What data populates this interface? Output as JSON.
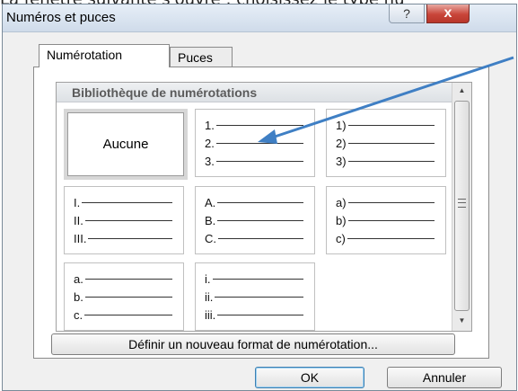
{
  "background_text": "La fenêtre suivante s'ouvre : choisissez le type nu",
  "dialog": {
    "title": "Numéros et puces",
    "help_label": "?",
    "close_label": "x"
  },
  "tabs": [
    {
      "label": "Numérotation",
      "active": true
    },
    {
      "label": "Puces",
      "active": false
    }
  ],
  "gallery": {
    "header": "Bibliothèque de numérotations",
    "none_label": "Aucune",
    "formats": [
      [
        "1.",
        "2.",
        "3."
      ],
      [
        "1)",
        "2)",
        "3)"
      ],
      [
        "I.",
        "II.",
        "III."
      ],
      [
        "A.",
        "B.",
        "C."
      ],
      [
        "a)",
        "b)",
        "c)"
      ],
      [
        "a.",
        "b.",
        "c."
      ],
      [
        "i.",
        "ii.",
        "iii."
      ]
    ]
  },
  "buttons": {
    "define": "Définir un nouveau format de numérotation...",
    "ok": "OK",
    "cancel": "Annuler"
  },
  "colors": {
    "annotation_arrow": "#3f7fc4",
    "close_button": "#c9463a"
  }
}
